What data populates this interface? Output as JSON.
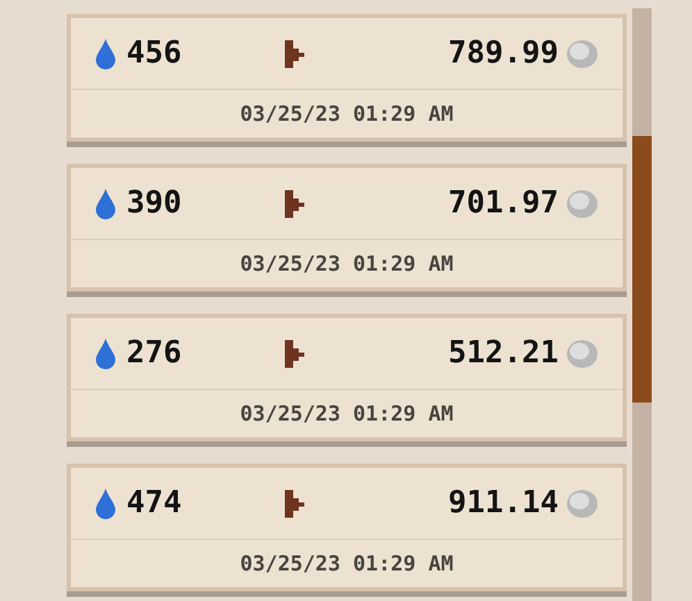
{
  "transactions": [
    {
      "amount": "456",
      "price": "789.99",
      "date": "03/25/23 01:29 AM"
    },
    {
      "amount": "390",
      "price": "701.97",
      "date": "03/25/23 01:29 AM"
    },
    {
      "amount": "276",
      "price": "512.21",
      "date": "03/25/23 01:29 AM"
    },
    {
      "amount": "474",
      "price": "911.14",
      "date": "03/25/23 01:29 AM"
    }
  ]
}
